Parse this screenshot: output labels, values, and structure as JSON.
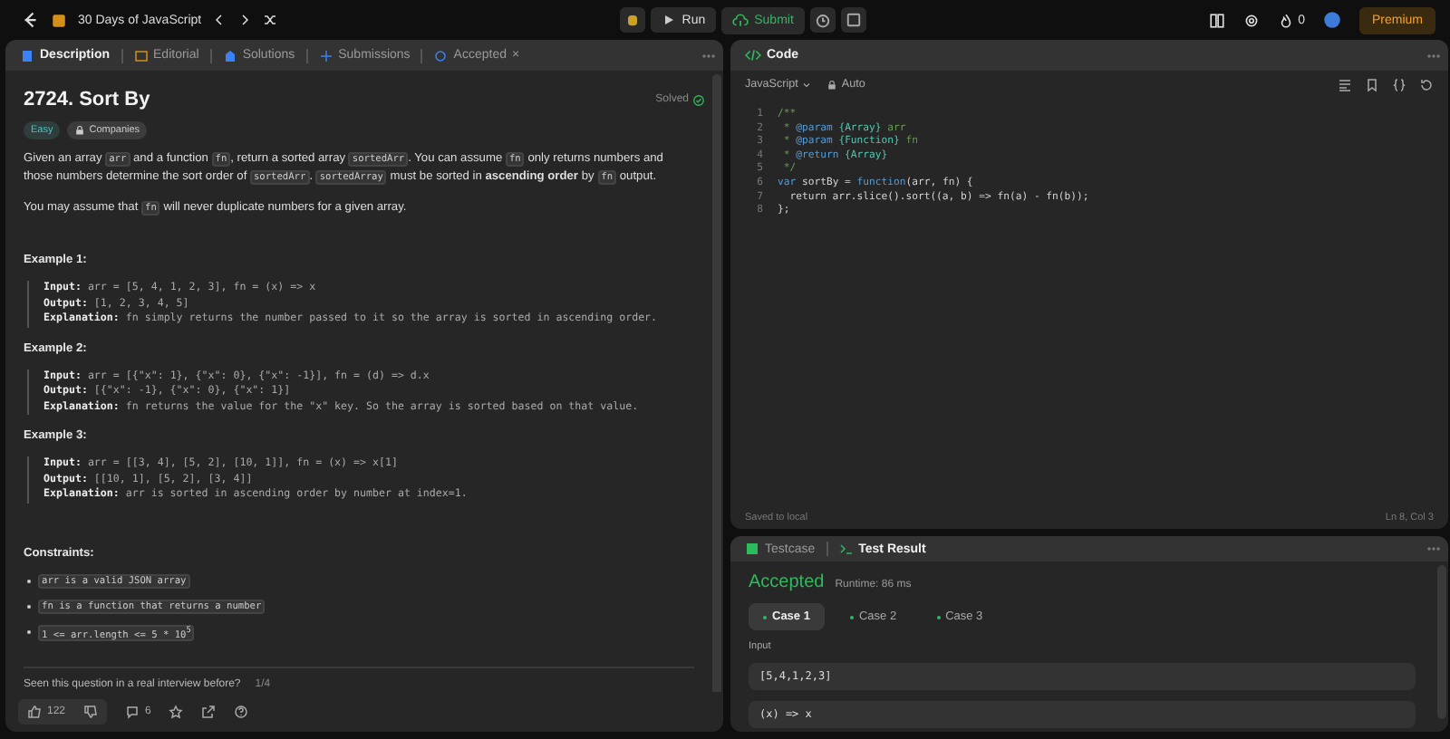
{
  "top_bar": {
    "study_plan": "30 Days of JavaScript",
    "run": "Run",
    "submit": "Submit",
    "streak": "0",
    "premium": "Premium"
  },
  "description_panel": {
    "tabs": [
      {
        "label": "Description",
        "selected": true
      },
      {
        "label": "Editorial",
        "selected": false
      },
      {
        "label": "Solutions",
        "selected": false
      },
      {
        "label": "Submissions",
        "selected": false
      },
      {
        "label": "Accepted",
        "selected": false,
        "close": "×"
      }
    ],
    "title": "2724. Sort By",
    "status": "Solved",
    "difficulty": "Easy",
    "companies": "Companies",
    "paragraphs": [
      [
        {
          "kind": "text",
          "text": "Given an array "
        },
        {
          "kind": "code",
          "text": "arr"
        },
        {
          "kind": "text",
          "text": " and a function "
        },
        {
          "kind": "code",
          "text": "fn"
        },
        {
          "kind": "text",
          "text": ", return a sorted array "
        },
        {
          "kind": "code",
          "text": "sortedArr"
        },
        {
          "kind": "text",
          "text": ". You can assume "
        },
        {
          "kind": "code",
          "text": "fn"
        },
        {
          "kind": "text",
          "text": " only returns numbers and those numbers determine the sort order of "
        },
        {
          "kind": "code",
          "text": "sortedArr"
        },
        {
          "kind": "text",
          "text": ". "
        },
        {
          "kind": "code",
          "text": "sortedArray"
        },
        {
          "kind": "text",
          "text": " must be sorted in **ascending order** by "
        },
        {
          "kind": "code",
          "text": "fn"
        },
        {
          "kind": "text",
          "text": " output."
        }
      ],
      [
        {
          "kind": "text",
          "text": "You may assume that "
        },
        {
          "kind": "code",
          "text": "fn"
        },
        {
          "kind": "text",
          "text": " will never duplicate numbers for a given array."
        }
      ]
    ],
    "examples": [
      {
        "heading": "Example 1:",
        "lines": [
          {
            "label": "Input:",
            "value": "arr = [5, 4, 1, 2, 3], fn = (x) => x"
          },
          {
            "label": "Output:",
            "value": "[1, 2, 3, 4, 5]"
          },
          {
            "label": "Explanation:",
            "value": "fn simply returns the number passed to it so the array is sorted in ascending order."
          }
        ]
      },
      {
        "heading": "Example 2:",
        "lines": [
          {
            "label": "Input:",
            "value": "arr = [{\"x\": 1}, {\"x\": 0}, {\"x\": -1}], fn = (d) => d.x"
          },
          {
            "label": "Output:",
            "value": "[{\"x\": -1}, {\"x\": 0}, {\"x\": 1}]"
          },
          {
            "label": "Explanation:",
            "value": "fn returns the value for the \"x\" key. So the array is sorted based on that value."
          }
        ]
      },
      {
        "heading": "Example 3:",
        "lines": [
          {
            "label": "Input:",
            "value": "arr = [[3, 4], [5, 2], [10, 1]], fn = (x) => x[1]"
          },
          {
            "label": "Output:",
            "value": "[[10, 1], [5, 2], [3, 4]]"
          },
          {
            "label": "Explanation:",
            "value": "arr is sorted in ascending order by number at index=1."
          }
        ]
      }
    ],
    "constraints_heading": "Constraints:",
    "constraints": [
      "arr is a valid JSON array",
      "fn is a function that returns a number",
      "1 <= arr.length <= 5 * 10$^{5}$"
    ],
    "interview_question": "Seen this question in a real interview before?",
    "interview_page": "1/4",
    "likes": "122",
    "comments": "6"
  },
  "code_panel": {
    "title": "Code",
    "language": "JavaScript",
    "mode": "Auto",
    "lines": [
      {
        "n": "1",
        "tokens": [
          {
            "kind": "comment",
            "text": "/**"
          }
        ]
      },
      {
        "n": "2",
        "tokens": [
          {
            "kind": "comment",
            "text": " * "
          },
          {
            "kind": "tag",
            "text": "@param"
          },
          {
            "kind": "type",
            "text": " {Array}"
          },
          {
            "kind": "comment",
            "text": " arr"
          }
        ]
      },
      {
        "n": "3",
        "tokens": [
          {
            "kind": "comment",
            "text": " * "
          },
          {
            "kind": "tag",
            "text": "@param"
          },
          {
            "kind": "type",
            "text": " {Function}"
          },
          {
            "kind": "comment",
            "text": " fn"
          }
        ]
      },
      {
        "n": "4",
        "tokens": [
          {
            "kind": "comment",
            "text": " * "
          },
          {
            "kind": "tag",
            "text": "@return"
          },
          {
            "kind": "type",
            "text": " {Array}"
          }
        ]
      },
      {
        "n": "5",
        "tokens": [
          {
            "kind": "comment",
            "text": " */"
          }
        ]
      },
      {
        "n": "6",
        "tokens": [
          {
            "kind": "keyword",
            "text": "var"
          },
          {
            "kind": "plain",
            "text": " sortBy = "
          },
          {
            "kind": "keyword",
            "text": "function"
          },
          {
            "kind": "plain",
            "text": "(arr, fn) {"
          }
        ]
      },
      {
        "n": "7",
        "tokens": [
          {
            "kind": "plain",
            "text": "  return arr.slice().sort((a, b) => fn(a) - fn(b));"
          }
        ]
      },
      {
        "n": "8",
        "tokens": [
          {
            "kind": "plain",
            "text": "};"
          }
        ]
      }
    ],
    "saved": "Saved to local",
    "cursor": "Ln 8, Col 3"
  },
  "result_panel": {
    "tabs": [
      {
        "label": "Testcase",
        "selected": false
      },
      {
        "label": "Test Result",
        "selected": true
      }
    ],
    "verdict": "Accepted",
    "runtime": "Runtime: 86 ms",
    "cases": [
      {
        "label": "Case 1",
        "selected": true
      },
      {
        "label": "Case 2",
        "selected": false
      },
      {
        "label": "Case 3",
        "selected": false
      }
    ],
    "input_label": "Input",
    "inputs": [
      "[5,4,1,2,3]",
      "(x) => x"
    ]
  }
}
